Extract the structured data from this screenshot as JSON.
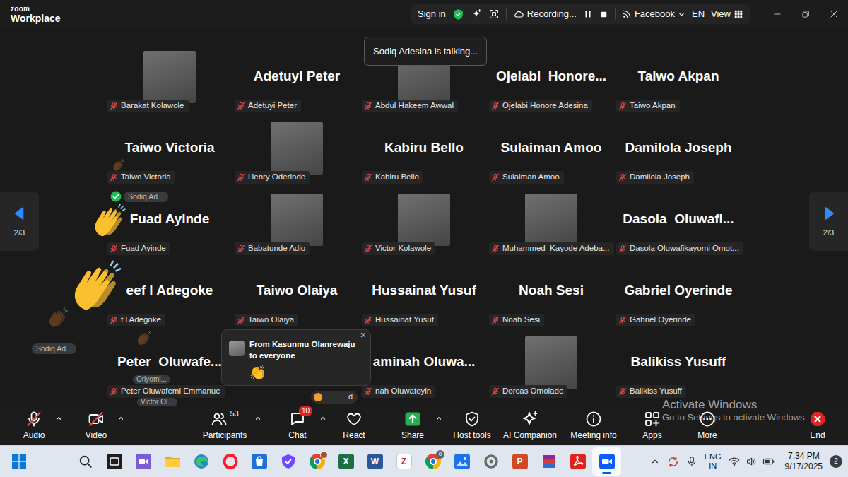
{
  "window": {
    "logo": "zoom",
    "product": "Workplace"
  },
  "topbar": {
    "sign_in": "Sign in",
    "recording": "Recording...",
    "stream": "Facebook",
    "language": "EN",
    "view": "View"
  },
  "speaking": {
    "text": "Sodiq Adesina is talking..."
  },
  "pager": [
    {
      "kind": "prev",
      "text": "2/3"
    },
    {
      "kind": "next",
      "text": "2/3"
    }
  ],
  "tiles": [
    {
      "kind": "photo",
      "label": "Barakat Kolawole",
      "muted": true
    },
    {
      "kind": "name",
      "name": "Adetuyi Peter",
      "label": "Adetuyi Peter",
      "muted": true
    },
    {
      "kind": "photo",
      "label": "Abdul Hakeem Awwal",
      "muted": true
    },
    {
      "kind": "name",
      "name": "Ojelabi  Honore...",
      "label": "Ojelabi Honore Adesina",
      "muted": true
    },
    {
      "kind": "name",
      "name": "Taiwo Akpan",
      "label": "Taiwo Akpan",
      "muted": true
    },
    {
      "kind": "name",
      "name": "Taiwo Victoria",
      "label": "Taiwo Victoria",
      "muted": true
    },
    {
      "kind": "photo",
      "label": "Henry Oderinde",
      "muted": true
    },
    {
      "kind": "name",
      "name": "Kabiru Bello",
      "label": "Kabiru Bello",
      "muted": true
    },
    {
      "kind": "name",
      "name": "Sulaiman Amoo",
      "label": "Sulaiman Amoo",
      "muted": true
    },
    {
      "kind": "name",
      "name": "Damilola Joseph",
      "label": "Damilola Joseph",
      "muted": true
    },
    {
      "kind": "name",
      "name": "Fuad Ayinde",
      "label": "Fuad Ayinde",
      "muted": true
    },
    {
      "kind": "photo",
      "label": "Babatunde Adio",
      "muted": true
    },
    {
      "kind": "photo",
      "label": "Victor Kolawole",
      "muted": true
    },
    {
      "kind": "photo",
      "label": "Muhammed  Kayode Adeba...",
      "muted": true
    },
    {
      "kind": "name",
      "name": "Dasola  Oluwafi...",
      "label": "Dasola Oluwafikayomi Omot...",
      "muted": true
    },
    {
      "kind": "name",
      "name": "eef l Adegoke",
      "label": "f l Adegoke",
      "muted": true
    },
    {
      "kind": "name",
      "name": "Taiwo Olaiya",
      "label": "Taiwo Olaiya",
      "muted": true
    },
    {
      "kind": "name",
      "name": "Hussainat Yusuf",
      "label": "Hussainat Yusuf",
      "muted": true
    },
    {
      "kind": "name",
      "name": "Noah Sesi",
      "label": "Noah Sesi",
      "muted": true
    },
    {
      "kind": "name",
      "name": "Gabriel Oyerinde",
      "label": "Gabriel Oyerinde",
      "muted": true
    },
    {
      "kind": "name",
      "name": "Peter  Oluwafe...",
      "label": "Peter Oluwafemi Emmanue",
      "muted": true
    },
    {
      "kind": "hidden"
    },
    {
      "kind": "name",
      "name": "aminah Oluwa...",
      "label": "nah Oluwatoyin",
      "muted": true
    },
    {
      "kind": "photo",
      "label": "Dorcas Omolade",
      "muted": true
    },
    {
      "kind": "name",
      "name": "Balikiss Yusuff",
      "label": "Balikiss Yusuff",
      "muted": true
    }
  ],
  "reactions": {
    "emojis": [
      {
        "color": "#fbc02d"
      },
      {
        "color": "#fbc02d"
      },
      {
        "color": "#6b4423"
      },
      {
        "color": "#6b4423"
      },
      {
        "color": "#6b4423"
      }
    ],
    "tags": [
      {
        "text": "Sodiq Ad...",
        "checked": true
      },
      {
        "text": "Sodiq Ad...",
        "checked": false
      },
      {
        "text": "Oriyomi...",
        "checked": false
      },
      {
        "text": "Victor Ol...",
        "checked": false
      }
    ]
  },
  "chat_popup": {
    "sender": "From Kasunmu Olanrewaju",
    "recipient": "to everyone",
    "message": "👏",
    "close": "×"
  },
  "notice": {
    "text": "d"
  },
  "toolbar": [
    {
      "kind": "audio",
      "label": "Audio",
      "muted": true
    },
    {
      "kind": "caret"
    },
    {
      "kind": "video",
      "label": "Video",
      "muted": true
    },
    {
      "kind": "caret"
    },
    {
      "kind": "participants",
      "label": "Participants",
      "count": "53"
    },
    {
      "kind": "caret"
    },
    {
      "kind": "chat",
      "label": "Chat",
      "badge": "10"
    },
    {
      "kind": "caret"
    },
    {
      "kind": "react",
      "label": "React"
    },
    {
      "kind": "share",
      "label": "Share"
    },
    {
      "kind": "caret"
    },
    {
      "kind": "host",
      "label": "Host tools"
    },
    {
      "kind": "ai",
      "label": "AI Companion"
    },
    {
      "kind": "info",
      "label": "Meeting info"
    },
    {
      "kind": "apps",
      "label": "Apps"
    },
    {
      "kind": "more",
      "label": "More"
    },
    {
      "kind": "end",
      "label": "End"
    }
  ],
  "watermark": {
    "title": "Activate Windows",
    "subtitle": "Go to Settings to activate Windows."
  },
  "taskbar": {
    "apps": [
      {
        "kind": "search",
        "selected": false
      },
      {
        "kind": "taskview",
        "selected": false
      },
      {
        "kind": "camera",
        "selected": false
      },
      {
        "kind": "folder",
        "selected": false
      },
      {
        "kind": "edge",
        "selected": false
      },
      {
        "kind": "opera",
        "selected": false
      },
      {
        "kind": "store",
        "selected": false
      },
      {
        "kind": "vpn",
        "selected": false
      },
      {
        "kind": "chrome",
        "selected": false
      },
      {
        "kind": "excel",
        "glyph": "X",
        "selected": false
      },
      {
        "kind": "word",
        "glyph": "W",
        "selected": false
      },
      {
        "kind": "zotero",
        "glyph": "Z",
        "selected": false
      },
      {
        "kind": "chromebadge",
        "badge": "0",
        "selected": false
      },
      {
        "kind": "photos",
        "selected": false
      },
      {
        "kind": "ring",
        "selected": false
      },
      {
        "kind": "powerpoint",
        "glyph": "P",
        "selected": false
      },
      {
        "kind": "archive",
        "selected": false
      },
      {
        "kind": "acrobat",
        "selected": false
      },
      {
        "kind": "zoom",
        "selected": true
      }
    ],
    "tray": {
      "language": "ENG",
      "region": "IN",
      "time": "7:34 PM",
      "date": "9/17/2025",
      "notifications": "2"
    }
  }
}
